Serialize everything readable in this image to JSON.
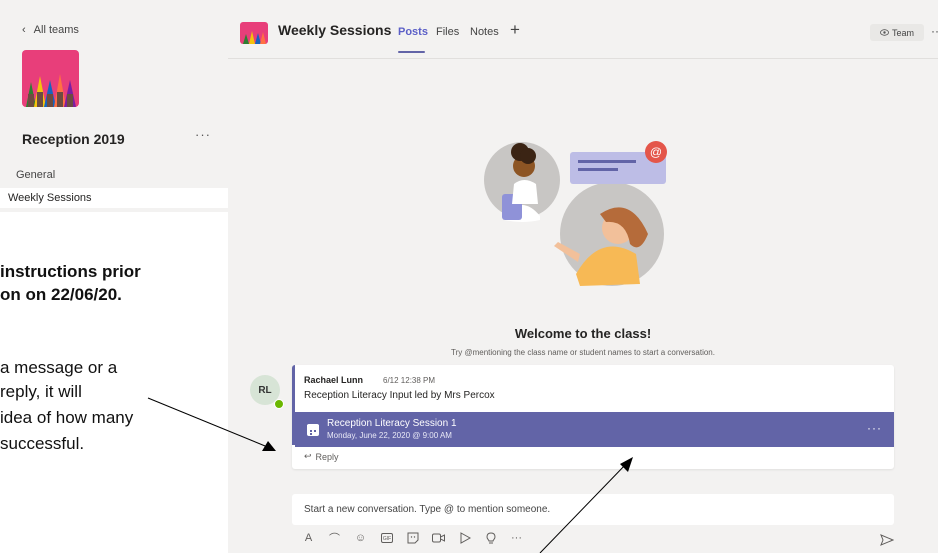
{
  "sidebar": {
    "back_label": "All teams",
    "team_name": "Reception 2019",
    "more": "···",
    "channels": [
      {
        "label": "General"
      },
      {
        "label": "Weekly Sessions"
      }
    ]
  },
  "instructions": {
    "line1": "instructions prior",
    "line2": "on on 22/06/20.",
    "line3": "a message or a",
    "line4": "reply, it will",
    "line5": "idea of how many",
    "line6": "successful."
  },
  "header": {
    "title": "Weekly Sessions",
    "tabs": [
      {
        "label": "Posts"
      },
      {
        "label": "Files"
      },
      {
        "label": "Notes"
      }
    ],
    "add": "+",
    "team_button": "Team",
    "more": "··"
  },
  "welcome": {
    "title": "Welcome to the class!",
    "subtitle": "Try @mentioning the class name or student names to start a conversation."
  },
  "post": {
    "avatar_initials": "RL",
    "author": "Rachael Lunn",
    "time": "6/12 12:38 PM",
    "body": "Reception Literacy Input led by Mrs Percox",
    "meeting_title": "Reception Literacy Session 1",
    "meeting_date": "Monday, June 22, 2020 @ 9:00 AM",
    "meeting_more": "···",
    "reply_label": "Reply"
  },
  "composer": {
    "placeholder": "Start a new conversation. Type @ to mention someone.",
    "more": "···"
  },
  "colors": {
    "accent": "#6264a7",
    "presence": "#6bb700",
    "background": "#f3f2f1"
  }
}
